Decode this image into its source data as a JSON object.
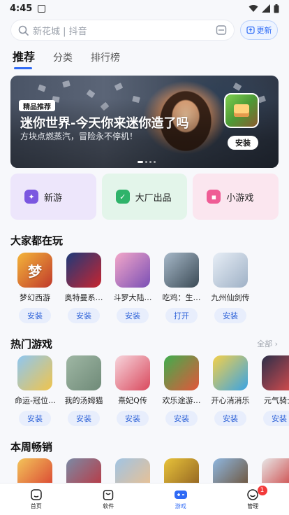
{
  "status_bar": {
    "time": "4:45"
  },
  "search": {
    "placeholder": "新花城 | 抖音",
    "update_label": "更新"
  },
  "tabs": [
    {
      "label": "推荐",
      "active": true
    },
    {
      "label": "分类",
      "active": false
    },
    {
      "label": "排行榜",
      "active": false
    }
  ],
  "banner": {
    "badge": "精品推荐",
    "title": "迷你世界-今天你来迷你造了吗",
    "subtitle": "方块点燃蒸汽，冒险永不停机！",
    "install_label": "安装",
    "page_count": 4,
    "active_page": 1
  },
  "categories": [
    {
      "label": "新游",
      "icon": "new-game-icon",
      "bg": "#ede6fb",
      "icon_color": "#7b57e0"
    },
    {
      "label": "大厂出品",
      "icon": "studio-icon",
      "bg": "#e3f5ea",
      "icon_color": "#2fb36a"
    },
    {
      "label": "小游戏",
      "icon": "mini-game-icon",
      "bg": "#fbe6ef",
      "icon_color": "#ef5c95"
    }
  ],
  "section_popular": {
    "title": "大家都在玩",
    "apps": [
      {
        "name": "梦幻西游",
        "action": "安装",
        "color1": "#f4b53a",
        "color2": "#c0392b",
        "glyph": "梦"
      },
      {
        "name": "奥特曼系…",
        "action": "安装",
        "color1": "#1d3a7a",
        "color2": "#c8242f",
        "glyph": ""
      },
      {
        "name": "斗罗大陆…",
        "action": "安装",
        "color1": "#f3a7c9",
        "color2": "#7a4fb5",
        "glyph": ""
      },
      {
        "name": "吃鸡：生…",
        "action": "打开",
        "color1": "#a7b9c9",
        "color2": "#3b4a55",
        "glyph": ""
      },
      {
        "name": "九州仙剑传",
        "action": "安装",
        "color1": "#e7eef6",
        "color2": "#9fb1c6",
        "glyph": ""
      }
    ]
  },
  "section_hot": {
    "title": "热门游戏",
    "more_label": "全部 ›",
    "apps": [
      {
        "name": "命运-冠位…",
        "action": "安装",
        "color1": "#8ec7f2",
        "color2": "#f0c44b",
        "glyph": ""
      },
      {
        "name": "我的汤姆猫",
        "action": "安装",
        "color1": "#9fb7a4",
        "color2": "#6f8a78",
        "glyph": ""
      },
      {
        "name": "熹妃Q传",
        "action": "安装",
        "color1": "#f7d5dc",
        "color2": "#d9495d",
        "glyph": ""
      },
      {
        "name": "欢乐途游…",
        "action": "安装",
        "color1": "#3fae4e",
        "color2": "#e4553a",
        "glyph": ""
      },
      {
        "name": "开心消消乐",
        "action": "安装",
        "color1": "#f4d04a",
        "color2": "#3aa3e3",
        "glyph": ""
      },
      {
        "name": "元气骑士",
        "action": "安装",
        "color1": "#2b2f4a",
        "color2": "#e04d4d",
        "glyph": ""
      }
    ]
  },
  "section_weekly": {
    "title": "本周畅销",
    "apps": [
      {
        "color1": "#f3c45a",
        "color2": "#d83a2f"
      },
      {
        "color1": "#7b8aa5",
        "color2": "#c0313a"
      },
      {
        "color1": "#a0c4e4",
        "color2": "#f1c08a"
      },
      {
        "color1": "#e8c33a",
        "color2": "#8a5a1f"
      },
      {
        "color1": "#8fb7e0",
        "color2": "#6a4a2a"
      },
      {
        "color1": "#e8e8e8",
        "color2": "#c82a2a"
      }
    ]
  },
  "bottom_nav": [
    {
      "label": "首页",
      "icon": "home-icon",
      "active": false
    },
    {
      "label": "软件",
      "icon": "software-bag-icon",
      "active": false
    },
    {
      "label": "游戏",
      "icon": "gamepad-icon",
      "active": true
    },
    {
      "label": "管理",
      "icon": "manage-icon",
      "active": false,
      "badge": "1"
    }
  ]
}
